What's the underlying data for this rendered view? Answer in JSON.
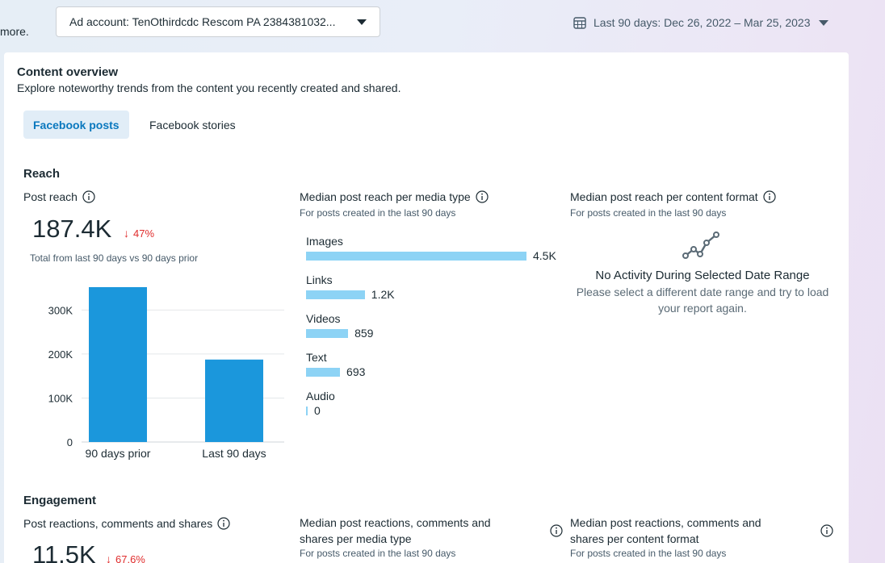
{
  "header": {
    "more_text": "more.",
    "ad_account_label": "Ad account: TenOthirdcdc Rescom PA 2384381032...",
    "date_range_label": "Last 90 days: Dec 26, 2022 – Mar 25, 2023"
  },
  "overview": {
    "title": "Content overview",
    "subtitle": "Explore noteworthy trends from the content you recently created and shared."
  },
  "tabs": [
    {
      "label": "Facebook posts",
      "active": true
    },
    {
      "label": "Facebook stories",
      "active": false
    }
  ],
  "reach": {
    "section_title": "Reach",
    "post_reach": {
      "title": "Post reach",
      "value": "187.4K",
      "delta": "47%",
      "caption": "Total from last 90 days vs 90 days prior"
    },
    "media_type": {
      "title": "Median post reach per media type",
      "caption": "For posts created in the last 90 days",
      "items": [
        {
          "label": "Images",
          "value_text": "4.5K",
          "value": 4500
        },
        {
          "label": "Links",
          "value_text": "1.2K",
          "value": 1200
        },
        {
          "label": "Videos",
          "value_text": "859",
          "value": 859
        },
        {
          "label": "Text",
          "value_text": "693",
          "value": 693
        },
        {
          "label": "Audio",
          "value_text": "0",
          "value": 0
        }
      ]
    },
    "content_format": {
      "title": "Median post reach per content format",
      "caption": "For posts created in the last 90 days",
      "empty_title": "No Activity During Selected Date Range",
      "empty_message": "Please select a different date range and try to load your report again."
    }
  },
  "engagement": {
    "section_title": "Engagement",
    "reactions": {
      "title": "Post reactions, comments and shares",
      "value": "11.5K",
      "delta": "67.6%"
    },
    "media_type": {
      "title_line1": "Median post reactions, comments and",
      "title_line2": "shares per media type",
      "caption": "For posts created in the last 90 days"
    },
    "content_format": {
      "title_line1": "Median post reactions, comments and",
      "title_line2": "shares per content format",
      "caption": "For posts created in the last 90 days"
    }
  },
  "chart_data": {
    "type": "bar",
    "categories": [
      "90 days prior",
      "Last 90 days"
    ],
    "values": [
      352000,
      187400
    ],
    "yticks": [
      "0",
      "100K",
      "200K",
      "300K"
    ],
    "ytick_values": [
      0,
      100000,
      200000,
      300000
    ],
    "ylim": [
      0,
      352000
    ],
    "grid": true,
    "color": "#1b97dc"
  },
  "colors": {
    "accent": "#0a78be",
    "negative": "#e02d2d",
    "media_bar": "#8dd3f5"
  }
}
